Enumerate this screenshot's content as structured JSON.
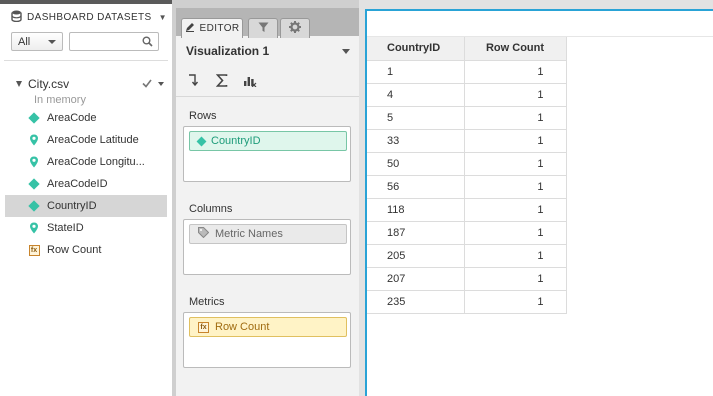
{
  "datasets": {
    "header": "DASHBOARD DATASETS",
    "filter_value": "All",
    "search_placeholder": "",
    "file_name": "City.csv",
    "file_status": "In memory",
    "fields": [
      {
        "label": "AreaCode",
        "icon": "attribute-diamond-icon"
      },
      {
        "label": "AreaCode Latitude",
        "icon": "geo-pin-icon"
      },
      {
        "label": "AreaCode Longitu...",
        "icon": "geo-pin-icon"
      },
      {
        "label": "AreaCodeID",
        "icon": "attribute-diamond-icon"
      },
      {
        "label": "CountryID",
        "icon": "attribute-diamond-icon",
        "selected": true
      },
      {
        "label": "StateID",
        "icon": "geo-pin-icon"
      },
      {
        "label": "Row Count",
        "icon": "metric-fx-icon"
      }
    ]
  },
  "editor": {
    "tab_label": "EDITOR",
    "viz_title": "Visualization 1",
    "rows_label": "Rows",
    "rows_item": "CountryID",
    "columns_label": "Columns",
    "columns_item": "Metric Names",
    "metrics_label": "Metrics",
    "metrics_item": "Row Count"
  },
  "grid": {
    "headers": [
      "CountryID",
      "Row Count"
    ],
    "rows": [
      [
        "1",
        "1"
      ],
      [
        "4",
        "1"
      ],
      [
        "5",
        "1"
      ],
      [
        "33",
        "1"
      ],
      [
        "50",
        "1"
      ],
      [
        "56",
        "1"
      ],
      [
        "118",
        "1"
      ],
      [
        "187",
        "1"
      ],
      [
        "205",
        "1"
      ],
      [
        "207",
        "1"
      ],
      [
        "235",
        "1"
      ]
    ]
  },
  "colors": {
    "accent_blue": "#29a3d6",
    "attribute_green": "#36c2a6",
    "metric_orange": "#c8842c",
    "selected_row": "#d6d6d6"
  }
}
